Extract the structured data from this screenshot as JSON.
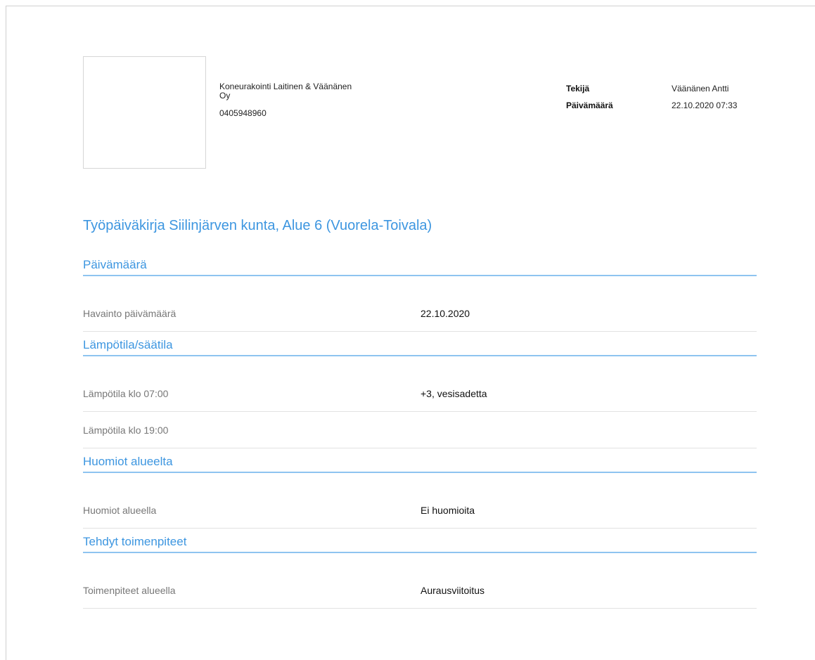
{
  "header": {
    "company_line1": "Koneurakointi Laitinen & Väänänen",
    "company_line2": "Oy",
    "phone": "0405948960",
    "meta": [
      {
        "label": "Tekijä",
        "value": "Väänänen Antti"
      },
      {
        "label": "Päivämäärä",
        "value": "22.10.2020 07:33"
      }
    ]
  },
  "title": "Työpäiväkirja Siilinjärven kunta, Alue 6 (Vuorela-Toivala)",
  "sections": [
    {
      "heading": "Päivämäärä",
      "rows": [
        {
          "label": "Havainto päivämäärä",
          "value": "22.10.2020"
        }
      ]
    },
    {
      "heading": "Lämpötila/säätila",
      "rows": [
        {
          "label": "Lämpötila klo 07:00",
          "value": "+3, vesisadetta"
        },
        {
          "label": "Lämpötila klo 19:00",
          "value": ""
        }
      ]
    },
    {
      "heading": "Huomiot alueelta",
      "rows": [
        {
          "label": "Huomiot alueella",
          "value": "Ei huomioita"
        }
      ]
    },
    {
      "heading": "Tehdyt toimenpiteet",
      "rows": [
        {
          "label": "Toimenpiteet alueella",
          "value": "Aurausviitoitus"
        }
      ]
    }
  ],
  "colors": {
    "accent": "#3d96e0",
    "accent_line": "#8ec4f0"
  }
}
